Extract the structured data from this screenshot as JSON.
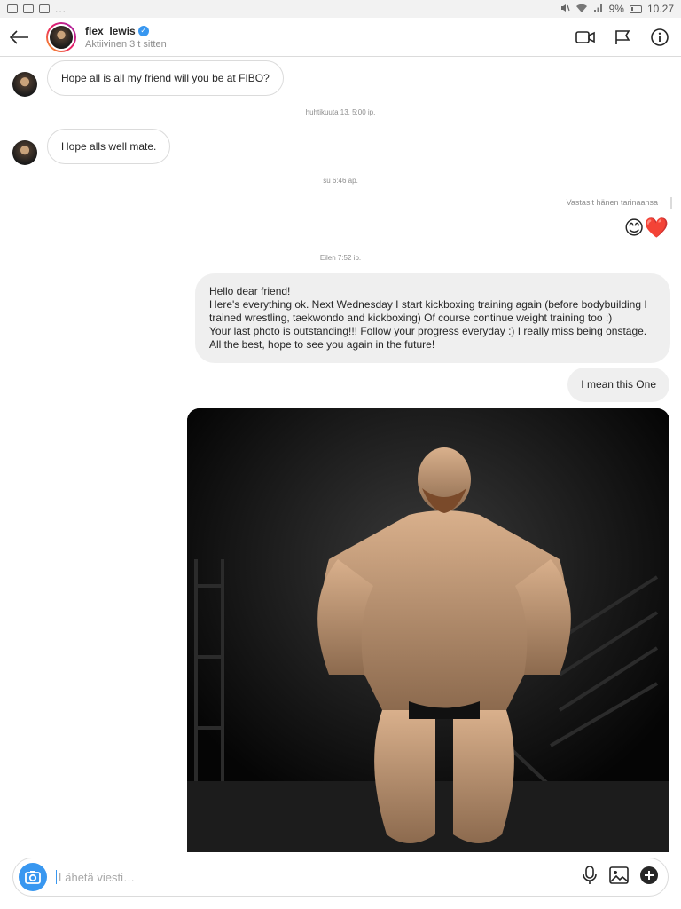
{
  "status_bar": {
    "dots": "...",
    "battery": "9%",
    "time": "10.27"
  },
  "header": {
    "username": "flex_lewis",
    "verified_badge": "✓",
    "active_status": "Aktiivinen 3 t sitten"
  },
  "messages": {
    "m1": "Hope all is all my friend will you be at FIBO?",
    "t1": "huhtikuuta 13, 5:00 ip.",
    "m2": "Hope alls well mate.",
    "t2": "su 6:46 ap.",
    "reply_note": "Vastasit hänen tarinaansa",
    "emoji": "😊❤️",
    "t3": "Eilen 7:52 ip.",
    "m3_lines": [
      "Hello dear friend!",
      "Here's everything ok. Next Wednesday I start kickboxing training again (before bodybuilding I",
      "trained wrestling,  taekwondo and kickboxing) Of course continue weight training too :)",
      "Your last photo is outstanding!!! Follow your progress everyday :) I really miss being onstage.",
      "All the best, hope to see you again in the future!"
    ],
    "m4": "I mean this One"
  },
  "composer": {
    "placeholder": "Lähetä viesti…"
  },
  "colors": {
    "accent": "#3897f0",
    "bubble_out": "#efefef",
    "border": "#dbdbdb"
  }
}
